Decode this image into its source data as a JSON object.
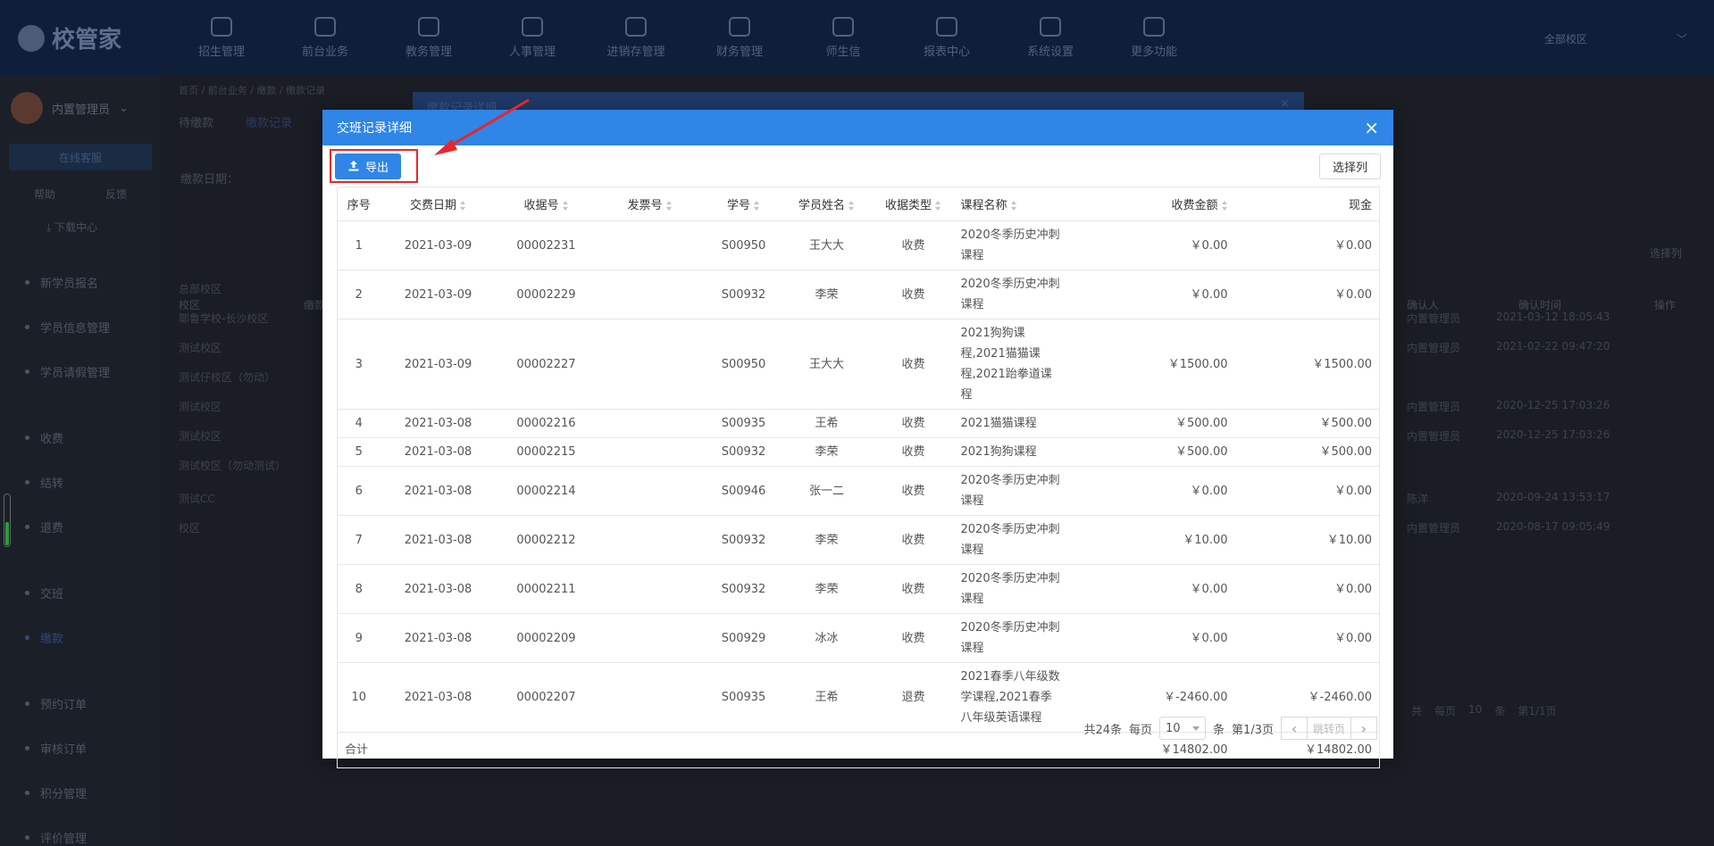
{
  "app": {
    "brand": "校管家",
    "campus": "全部校区"
  },
  "topnav": [
    "招生管理",
    "前台业务",
    "教务管理",
    "人事管理",
    "进销存管理",
    "财务管理",
    "师生信",
    "报表中心",
    "系统设置",
    "更多功能"
  ],
  "sidebar": {
    "user": "内置管理员",
    "online": "在线客服",
    "links": [
      "帮助",
      "反馈"
    ],
    "download": "下载中心",
    "items": [
      "新学员报名",
      "学员信息管理",
      "学员请假管理",
      "收费",
      "结转",
      "退费",
      "交班",
      "缴款",
      "预约订单",
      "审核订单",
      "积分管理",
      "评价管理"
    ]
  },
  "background": {
    "breadcrumb": "首页 / 前台业务 / 缴款 / 缴款记录",
    "tabs": [
      "待缴款",
      "缴款记录"
    ],
    "date_label": "缴款日期：",
    "select_col": "选择列",
    "behind_modal_title": "缴款记录详细",
    "headers": [
      "校区",
      "缴款",
      "确认人",
      "确认时间",
      "操作"
    ],
    "campus_col": [
      "总部校区",
      "耶鲁学校-长沙校区",
      "测试校区",
      "测试仔校区（勿动）",
      "测试校区",
      "测试校区",
      "测试校区（勿动测试）",
      "测试CC",
      "校区"
    ],
    "confirmers": [
      "",
      "内置管理员",
      "内置管理员",
      "",
      "内置管理员",
      "内置管理员",
      "",
      "陈洋",
      "内置管理员"
    ],
    "confirm_times": [
      "",
      "2021-03-12 18:05:43",
      "2021-02-22 09:47:20",
      "",
      "2020-12-25 17:03:26",
      "2020-12-25 17:03:26",
      "",
      "2020-09-24 13:53:17",
      "2020-08-17 09:05:49"
    ],
    "pager": [
      "共",
      "每页",
      "10",
      "条",
      "第1/1页"
    ]
  },
  "modal": {
    "title": "交班记录详细",
    "close": "×",
    "export_label": "导出",
    "select_columns": "选择列",
    "columns": [
      "序号",
      "交费日期",
      "收据号",
      "发票号",
      "学号",
      "学员姓名",
      "收据类型",
      "课程名称",
      "收费金额",
      "现金"
    ],
    "rows": [
      {
        "no": "1",
        "date": "2021-03-09",
        "receipt": "00002231",
        "invoice": "",
        "sid": "S00950",
        "name": "王大大",
        "type": "收费",
        "course": "2020冬季历史冲刺课程",
        "amount": "￥0.00",
        "cash": "￥0.00"
      },
      {
        "no": "2",
        "date": "2021-03-09",
        "receipt": "00002229",
        "invoice": "",
        "sid": "S00932",
        "name": "李荣",
        "type": "收费",
        "course": "2020冬季历史冲刺课程",
        "amount": "￥0.00",
        "cash": "￥0.00"
      },
      {
        "no": "3",
        "date": "2021-03-09",
        "receipt": "00002227",
        "invoice": "",
        "sid": "S00950",
        "name": "王大大",
        "type": "收费",
        "course": "2021狗狗课程,2021猫猫课程,2021跆拳道课程",
        "amount": "￥1500.00",
        "cash": "￥1500.00"
      },
      {
        "no": "4",
        "date": "2021-03-08",
        "receipt": "00002216",
        "invoice": "",
        "sid": "S00935",
        "name": "王希",
        "type": "收费",
        "course": "2021猫猫课程",
        "amount": "￥500.00",
        "cash": "￥500.00"
      },
      {
        "no": "5",
        "date": "2021-03-08",
        "receipt": "00002215",
        "invoice": "",
        "sid": "S00932",
        "name": "李荣",
        "type": "收费",
        "course": "2021狗狗课程",
        "amount": "￥500.00",
        "cash": "￥500.00"
      },
      {
        "no": "6",
        "date": "2021-03-08",
        "receipt": "00002214",
        "invoice": "",
        "sid": "S00946",
        "name": "张一二",
        "type": "收费",
        "course": "2020冬季历史冲刺课程",
        "amount": "￥0.00",
        "cash": "￥0.00"
      },
      {
        "no": "7",
        "date": "2021-03-08",
        "receipt": "00002212",
        "invoice": "",
        "sid": "S00932",
        "name": "李荣",
        "type": "收费",
        "course": "2020冬季历史冲刺课程",
        "amount": "￥10.00",
        "cash": "￥10.00"
      },
      {
        "no": "8",
        "date": "2021-03-08",
        "receipt": "00002211",
        "invoice": "",
        "sid": "S00932",
        "name": "李荣",
        "type": "收费",
        "course": "2020冬季历史冲刺课程",
        "amount": "￥0.00",
        "cash": "￥0.00"
      },
      {
        "no": "9",
        "date": "2021-03-08",
        "receipt": "00002209",
        "invoice": "",
        "sid": "S00929",
        "name": "冰冰",
        "type": "收费",
        "course": "2020冬季历史冲刺课程",
        "amount": "￥0.00",
        "cash": "￥0.00"
      },
      {
        "no": "10",
        "date": "2021-03-08",
        "receipt": "00002207",
        "invoice": "",
        "sid": "S00935",
        "name": "王希",
        "type": "退费",
        "course": "2021春季八年级数学课程,2021春季八年级英语课程",
        "amount": "￥-2460.00",
        "cash": "￥-2460.00"
      }
    ],
    "total": {
      "label": "合计",
      "amount": "￥14802.00",
      "cash": "￥14802.00"
    },
    "pagination": {
      "total": "共24条",
      "per_page_label": "每页",
      "page_size": "10",
      "unit": "条",
      "page_info": "第1/3页",
      "jump": "跳转页"
    }
  },
  "colors": {
    "primary": "#2f86e6",
    "highlight": "#e8262d"
  }
}
